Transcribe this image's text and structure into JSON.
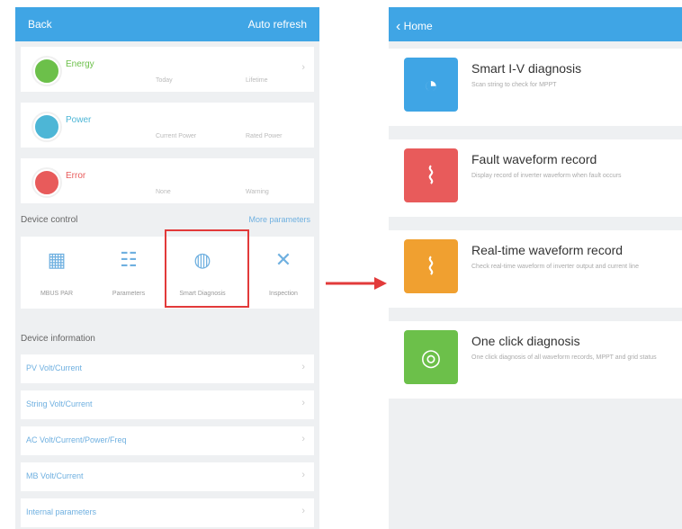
{
  "left_screen": {
    "header": {
      "back_label": "Back",
      "right_label": "Auto refresh"
    },
    "summary_cards": [
      {
        "title": "Energy",
        "sub1": "Today",
        "sub2": "Lifetime",
        "color": "#6cc04a"
      },
      {
        "title": "Power",
        "sub1": "Current Power",
        "sub2": "Rated Power",
        "color": "#4db6d6"
      },
      {
        "title": "Error",
        "sub1": "None",
        "sub2": "Warning",
        "color": "#e85b5b"
      }
    ],
    "device_control": {
      "section_title": "Device control",
      "link_label": "More parameters",
      "items": [
        {
          "label": "MBUS PAR",
          "icon": "solar-panel-icon"
        },
        {
          "label": "Parameters",
          "icon": "sliders-icon"
        },
        {
          "label": "Smart Diagnosis",
          "icon": "globe-icon"
        },
        {
          "label": "Inspection",
          "icon": "tools-icon"
        }
      ]
    },
    "device_information": {
      "section_title": "Device information",
      "rows": [
        "PV Volt/Current",
        "String Volt/Current",
        "AC Volt/Current/Power/Freq",
        "MB Volt/Current",
        "Internal parameters"
      ]
    }
  },
  "right_screen": {
    "header": {
      "back_label": "Home"
    },
    "items": [
      {
        "title": "Smart I-V diagnosis",
        "desc": "Scan string to check for MPPT",
        "color": "#3fa5e5",
        "icon": "iv-curve-icon"
      },
      {
        "title": "Fault waveform record",
        "desc": "Display record of inverter waveform when fault occurs",
        "color": "#e85b5b",
        "icon": "fault-waveform-icon"
      },
      {
        "title": "Real-time waveform record",
        "desc": "Check real-time waveform of inverter output and current line",
        "color": "#f0a030",
        "icon": "realtime-waveform-icon"
      },
      {
        "title": "One click diagnosis",
        "desc": "One click diagnosis of all waveform records, MPPT and grid status",
        "color": "#6cc04a",
        "icon": "diagnosis-icon"
      }
    ]
  },
  "annotation": {
    "arrow_color": "#e23a3a"
  }
}
